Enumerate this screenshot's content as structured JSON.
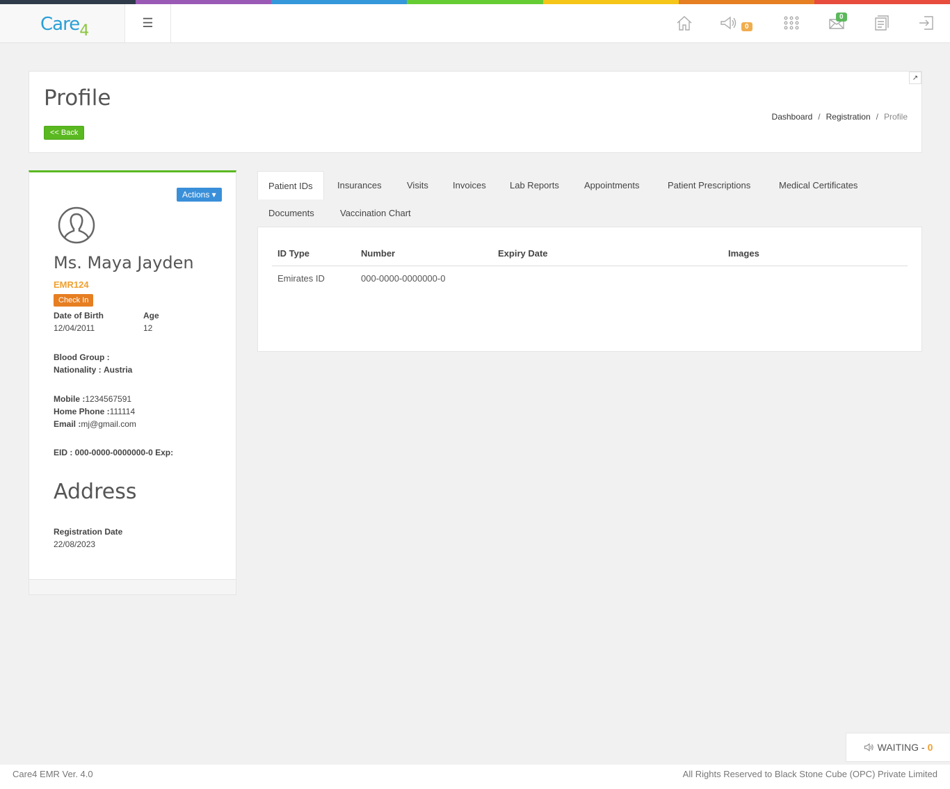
{
  "brand": {
    "logo_main": "Care",
    "logo_suffix": "4",
    "color_bar": [
      "#2f3b4a",
      "#9b59b6",
      "#3498db",
      "#66cc33",
      "#f5c518",
      "#e67e22",
      "#e74c3c"
    ]
  },
  "topbar": {
    "menu_icon": "☰",
    "icons": [
      {
        "name": "home-icon"
      },
      {
        "name": "megaphone-icon",
        "badge": "0",
        "badge_color": "#f0ad4e"
      },
      {
        "name": "apps-grid-icon"
      },
      {
        "name": "mail-icon",
        "badge": "0",
        "badge_color": "#5cb85c"
      },
      {
        "name": "document-icon"
      },
      {
        "name": "logout-icon"
      }
    ]
  },
  "header": {
    "title": "Profile",
    "back_label": "<< Back",
    "breadcrumb": [
      "Dashboard",
      "Registration",
      "Profile"
    ],
    "expand_icon": "↗"
  },
  "profile": {
    "actions_label": "Actions ▾",
    "name": "Ms. Maya Jayden",
    "emr": "EMR124",
    "checkin_label": "Check In",
    "dob_label": "Date of Birth",
    "dob": "12/04/2011",
    "age_label": "Age",
    "age": "12",
    "blood_group_label": "Blood Group :",
    "blood_group": "",
    "nationality_label": "Nationality :",
    "nationality": "Austria",
    "mobile_label": "Mobile :",
    "mobile": "1234567591",
    "home_phone_label": "Home Phone :",
    "home_phone": "111114",
    "email_label": "Email :",
    "email": "mj@gmail.com",
    "eid_line": "EID : 000-0000-0000000-0 Exp:",
    "address_title": "Address",
    "reg_date_label": "Registration Date",
    "reg_date": "22/08/2023"
  },
  "tabs": [
    {
      "label": "Patient IDs",
      "active": true
    },
    {
      "label": "Insurances"
    },
    {
      "label": "Visits"
    },
    {
      "label": "Invoices"
    },
    {
      "label": "Lab Reports"
    },
    {
      "label": "Appointments"
    },
    {
      "label": "Patient Prescriptions"
    },
    {
      "label": "Medical Certificates"
    },
    {
      "label": "Documents"
    },
    {
      "label": "Vaccination Chart"
    }
  ],
  "table": {
    "headers": [
      "ID Type",
      "Number",
      "Expiry Date",
      "Images"
    ],
    "rows": [
      [
        "Emirates ID",
        "000-0000-0000000-0",
        "",
        ""
      ]
    ]
  },
  "waiting": {
    "label": "WAITING - ",
    "count": "0"
  },
  "footer": {
    "version": "Care4 EMR Ver. 4.0",
    "copyright": "All Rights Reserved to Black Stone Cube (OPC) Private Limited"
  }
}
